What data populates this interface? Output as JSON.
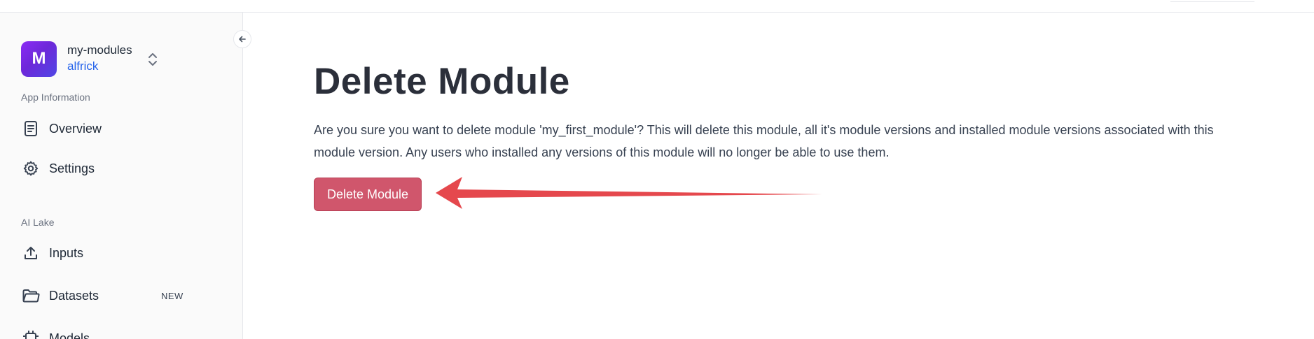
{
  "app": {
    "avatar_letter": "M",
    "name": "my-modules",
    "user": "alfrick"
  },
  "sidebar": {
    "sections": [
      {
        "label": "App Information",
        "items": [
          {
            "label": "Overview",
            "icon": "document-icon"
          },
          {
            "label": "Settings",
            "icon": "gear-icon"
          }
        ]
      },
      {
        "label": "AI Lake",
        "items": [
          {
            "label": "Inputs",
            "icon": "upload-icon"
          },
          {
            "label": "Datasets",
            "icon": "folder-icon",
            "badge": "NEW"
          },
          {
            "label": "Models",
            "icon": "chip-icon"
          }
        ]
      }
    ]
  },
  "main": {
    "title": "Delete Module",
    "description": "Are you sure you want to delete module 'my_first_module'? This will delete this module, all it's module versions and installed module versions associated with this module version. Any users who installed any versions of this module will no longer be able to use them.",
    "delete_button_label": "Delete Module"
  },
  "colors": {
    "accent_link": "#2563eb",
    "danger_button": "#d0566c",
    "annotation_arrow": "#e5484d",
    "avatar_gradient": [
      "#8b2cf5",
      "#4f46e5"
    ]
  }
}
